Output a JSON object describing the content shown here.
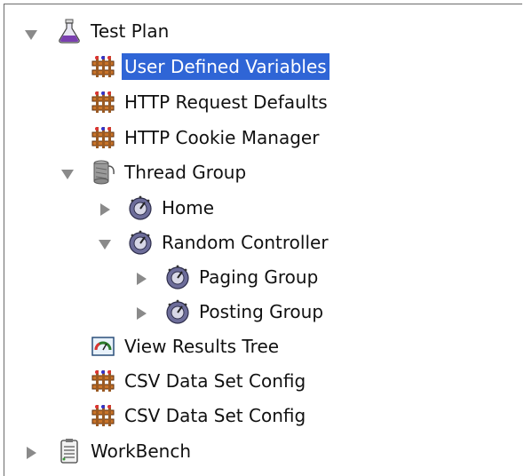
{
  "tree": {
    "test_plan": "Test Plan",
    "user_defined_variables": "User Defined Variables",
    "http_request_defaults": "HTTP Request Defaults",
    "http_cookie_manager": "HTTP Cookie Manager",
    "thread_group": "Thread Group",
    "home": "Home",
    "random_controller": "Random Controller",
    "paging_group": "Paging Group",
    "posting_group": "Posting Group",
    "view_results_tree": "View Results Tree",
    "csv_data_set_config_1": "CSV Data Set Config",
    "csv_data_set_config_2": "CSV Data Set Config",
    "workbench": "WorkBench"
  },
  "icons": {
    "test_plan": "flask-icon",
    "config": "config-element-icon",
    "thread_group": "thread-group-icon",
    "controller": "controller-knob-icon",
    "listener": "results-tree-icon",
    "workbench": "workbench-clipboard-icon"
  },
  "colors": {
    "selection": "#2f65d6",
    "toggle": "#8a8a8a"
  }
}
